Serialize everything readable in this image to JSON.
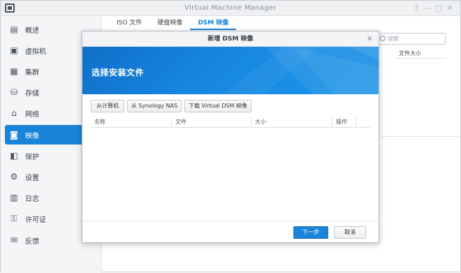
{
  "window": {
    "title": "Virtual Machine Manager",
    "controls": [
      "?",
      "—",
      "□",
      "✕"
    ]
  },
  "sidebar": {
    "items": [
      {
        "label": "概述",
        "icon": "overview-icon",
        "glyph": "▤"
      },
      {
        "label": "虚拟机",
        "icon": "vm-icon",
        "glyph": "▣"
      },
      {
        "label": "集群",
        "icon": "cluster-icon",
        "glyph": "▦"
      },
      {
        "label": "存储",
        "icon": "storage-icon",
        "glyph": "⛁"
      },
      {
        "label": "网络",
        "icon": "network-icon",
        "glyph": "⌂"
      },
      {
        "label": "映像",
        "icon": "image-icon",
        "glyph": "◙",
        "active": true
      },
      {
        "label": "保护",
        "icon": "protection-icon",
        "glyph": "◧"
      },
      {
        "label": "设置",
        "icon": "settings-icon",
        "glyph": "⚙"
      },
      {
        "label": "日志",
        "icon": "log-icon",
        "glyph": "▥"
      },
      {
        "label": "许可证",
        "icon": "license-icon",
        "glyph": "⚿"
      },
      {
        "label": "反馈",
        "icon": "feedback-icon",
        "glyph": "✉"
      }
    ]
  },
  "tabs": [
    {
      "label": "ISO 文件"
    },
    {
      "label": "硬盘映像"
    },
    {
      "label": "DSM 映像",
      "active": true
    }
  ],
  "search": {
    "placeholder": "搜索"
  },
  "background_table": {
    "column": "文件大小"
  },
  "modal": {
    "title": "新增 DSM 映像",
    "banner_title": "选择安装文件",
    "source_buttons": [
      "从计算机",
      "从 Synology NAS",
      "下载 Virtual DSM 映像"
    ],
    "columns": [
      "名称",
      "文件",
      "大小",
      "操作"
    ],
    "next_label": "下一步",
    "cancel_label": "取消"
  },
  "colors": {
    "accent": "#1a84d8",
    "banner": "#1787e0"
  }
}
